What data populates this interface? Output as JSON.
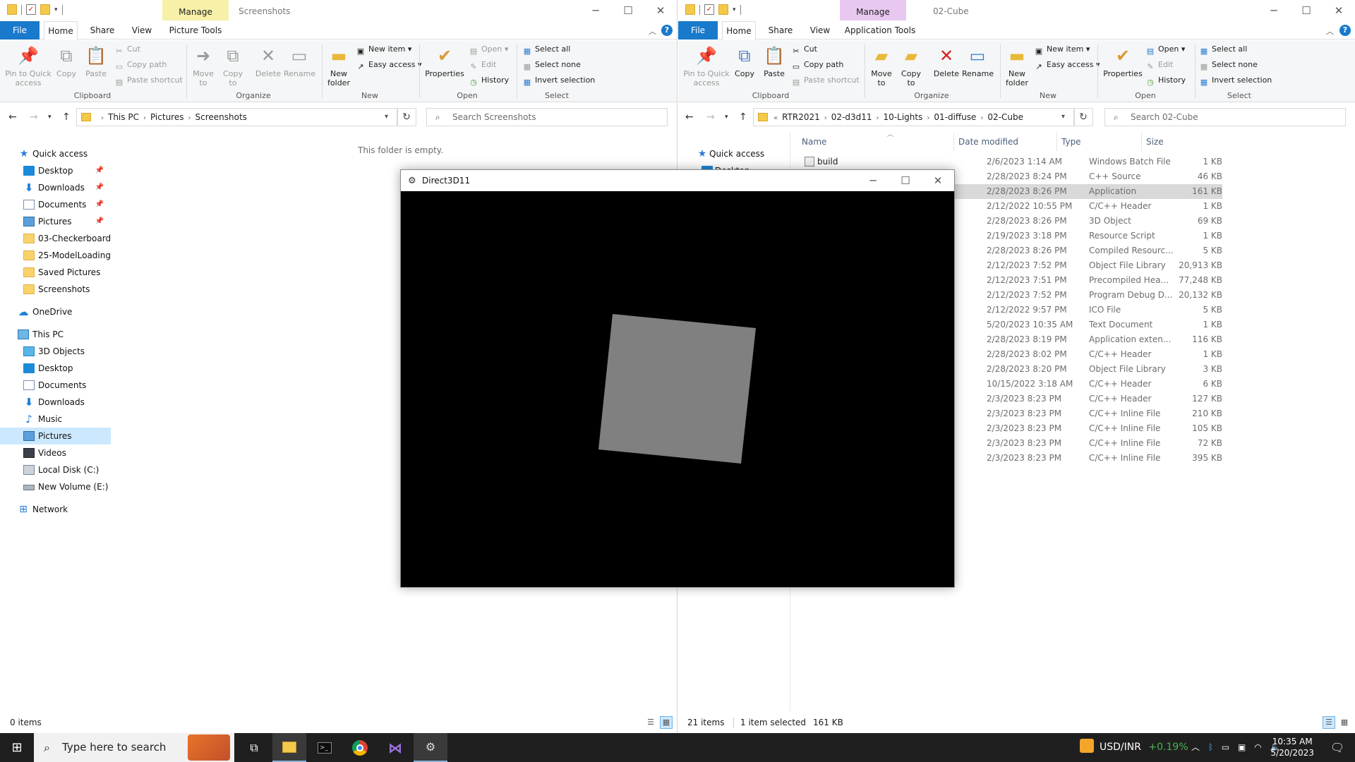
{
  "left": {
    "manage_tab": "Manage",
    "title": "Screenshots",
    "context_tab": "Picture Tools",
    "tabs": {
      "file": "File",
      "home": "Home",
      "share": "Share",
      "view": "View"
    },
    "ribbon": {
      "pin": "Pin to Quick access",
      "copy": "Copy",
      "paste": "Paste",
      "cut": "Cut",
      "copy_path": "Copy path",
      "paste_shortcut": "Paste shortcut",
      "move_to": "Move to",
      "copy_to": "Copy to",
      "delete": "Delete",
      "rename": "Rename",
      "new_folder": "New folder",
      "new_item": "New item",
      "easy_access": "Easy access",
      "properties": "Properties",
      "open": "Open",
      "edit": "Edit",
      "history": "History",
      "select_all": "Select all",
      "select_none": "Select none",
      "invert_selection": "Invert selection",
      "groups": {
        "clipboard": "Clipboard",
        "organize": "Organize",
        "new": "New",
        "open": "Open",
        "select": "Select"
      }
    },
    "breadcrumb": [
      "This PC",
      "Pictures",
      "Screenshots"
    ],
    "search_placeholder": "Search Screenshots",
    "empty_message": "This folder is empty.",
    "nav": {
      "quick_access": "Quick access",
      "desktop": "Desktop",
      "downloads": "Downloads",
      "documents": "Documents",
      "pictures": "Pictures",
      "checkerboard": "03-Checkerboard",
      "modelloading": "25-ModelLoading",
      "saved_pictures": "Saved Pictures",
      "screenshots": "Screenshots",
      "onedrive": "OneDrive",
      "this_pc": "This PC",
      "objects3d": "3D Objects",
      "desktop2": "Desktop",
      "documents2": "Documents",
      "downloads2": "Downloads",
      "music": "Music",
      "pictures2": "Pictures",
      "videos": "Videos",
      "local_disk": "Local Disk (C:)",
      "new_volume": "New Volume (E:)",
      "network": "Network"
    },
    "status": {
      "items": "0 items"
    }
  },
  "right": {
    "manage_tab": "Manage",
    "title": "02-Cube",
    "context_tab": "Application Tools",
    "tabs": {
      "file": "File",
      "home": "Home",
      "share": "Share",
      "view": "View"
    },
    "ribbon": {
      "pin": "Pin to Quick access",
      "copy": "Copy",
      "paste": "Paste",
      "cut": "Cut",
      "copy_path": "Copy path",
      "paste_shortcut": "Paste shortcut",
      "move_to": "Move to",
      "copy_to": "Copy to",
      "delete": "Delete",
      "rename": "Rename",
      "new_folder": "New folder",
      "new_item": "New item",
      "easy_access": "Easy access",
      "properties": "Properties",
      "open": "Open",
      "edit": "Edit",
      "history": "History",
      "select_all": "Select all",
      "select_none": "Select none",
      "invert_selection": "Invert selection",
      "groups": {
        "clipboard": "Clipboard",
        "organize": "Organize",
        "new": "New",
        "open": "Open",
        "select": "Select"
      }
    },
    "breadcrumb": [
      "RTR2021",
      "02-d3d11",
      "10-Lights",
      "01-diffuse",
      "02-Cube"
    ],
    "search_placeholder": "Search 02-Cube",
    "nav": {
      "quick_access": "Quick access",
      "desktop": "Desktop"
    },
    "columns": {
      "name": "Name",
      "date": "Date modified",
      "type": "Type",
      "size": "Size"
    },
    "first_name": "build",
    "files": [
      {
        "date": "2/6/2023 1:14 AM",
        "type": "Windows Batch File",
        "size": "1 KB"
      },
      {
        "date": "2/28/2023 8:24 PM",
        "type": "C++ Source",
        "size": "46 KB"
      },
      {
        "date": "2/28/2023 8:26 PM",
        "type": "Application",
        "size": "161 KB"
      },
      {
        "date": "2/12/2022 10:55 PM",
        "type": "C/C++ Header",
        "size": "1 KB"
      },
      {
        "date": "2/28/2023 8:26 PM",
        "type": "3D Object",
        "size": "69 KB"
      },
      {
        "date": "2/19/2023 3:18 PM",
        "type": "Resource Script",
        "size": "1 KB"
      },
      {
        "date": "2/28/2023 8:26 PM",
        "type": "Compiled Resourc...",
        "size": "5 KB"
      },
      {
        "date": "2/12/2023 7:52 PM",
        "type": "Object File Library",
        "size": "20,913 KB"
      },
      {
        "date": "2/12/2023 7:51 PM",
        "type": "Precompiled Hea...",
        "size": "77,248 KB"
      },
      {
        "date": "2/12/2023 7:52 PM",
        "type": "Program Debug D...",
        "size": "20,132 KB"
      },
      {
        "date": "2/12/2022 9:57 PM",
        "type": "ICO File",
        "size": "5 KB"
      },
      {
        "date": "5/20/2023 10:35 AM",
        "type": "Text Document",
        "size": "1 KB"
      },
      {
        "date": "2/28/2023 8:19 PM",
        "type": "Application exten...",
        "size": "116 KB"
      },
      {
        "date": "2/28/2023 8:02 PM",
        "type": "C/C++ Header",
        "size": "1 KB"
      },
      {
        "date": "2/28/2023 8:20 PM",
        "type": "Object File Library",
        "size": "3 KB"
      },
      {
        "date": "10/15/2022 3:18 AM",
        "type": "C/C++ Header",
        "size": "6 KB"
      },
      {
        "date": "2/3/2023 8:23 PM",
        "type": "C/C++ Header",
        "size": "127 KB"
      },
      {
        "date": "2/3/2023 8:23 PM",
        "type": "C/C++ Inline File",
        "size": "210 KB"
      },
      {
        "date": "2/3/2023 8:23 PM",
        "type": "C/C++ Inline File",
        "size": "105 KB"
      },
      {
        "date": "2/3/2023 8:23 PM",
        "type": "C/C++ Inline File",
        "size": "72 KB"
      },
      {
        "date": "2/3/2023 8:23 PM",
        "type": "C/C++ Inline File",
        "size": "395 KB"
      }
    ],
    "status": {
      "items": "21 items",
      "selected": "1 item selected",
      "size": "161 KB"
    }
  },
  "d3d": {
    "title": "Direct3D11"
  },
  "taskbar": {
    "search_placeholder": "Type here to search",
    "ticker_name": "USD/INR",
    "ticker_change": "+0.19%",
    "time": "10:35 AM",
    "date": "5/20/2023"
  },
  "colors": {
    "accent": "#1979ca",
    "manage_left": "#f7f0a8",
    "manage_right": "#e8c8f0",
    "selection": "#cce8ff",
    "quad": "#808080",
    "ticker_up": "#4caf50"
  }
}
